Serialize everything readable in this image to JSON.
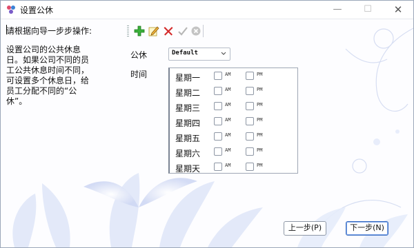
{
  "window": {
    "title": "设置公休",
    "min_glyph": "—",
    "max_glyph": "☐",
    "close_glyph": "✕"
  },
  "instructions": {
    "heading": "请根据向导一步步操作:",
    "body": "设置公司的公共休息日。如果公司不同的员工公共休息时间不同，可设置多个休息日，给员工分配不同的“公休”。"
  },
  "toolbar": {
    "icons": [
      "add-icon",
      "edit-icon",
      "delete-icon",
      "confirm-icon",
      "cancel-icon"
    ]
  },
  "form": {
    "holiday_label": "公休",
    "holiday_value": "Default",
    "time_label": "时间"
  },
  "schedule": {
    "am_label": "AM",
    "pm_label": "PM",
    "days": [
      "星期一",
      "星期二",
      "星期三",
      "星期四",
      "星期五",
      "星期六",
      "星期天"
    ]
  },
  "footer": {
    "prev_label": "上一步(P)",
    "next_label": "下一步(N)"
  }
}
